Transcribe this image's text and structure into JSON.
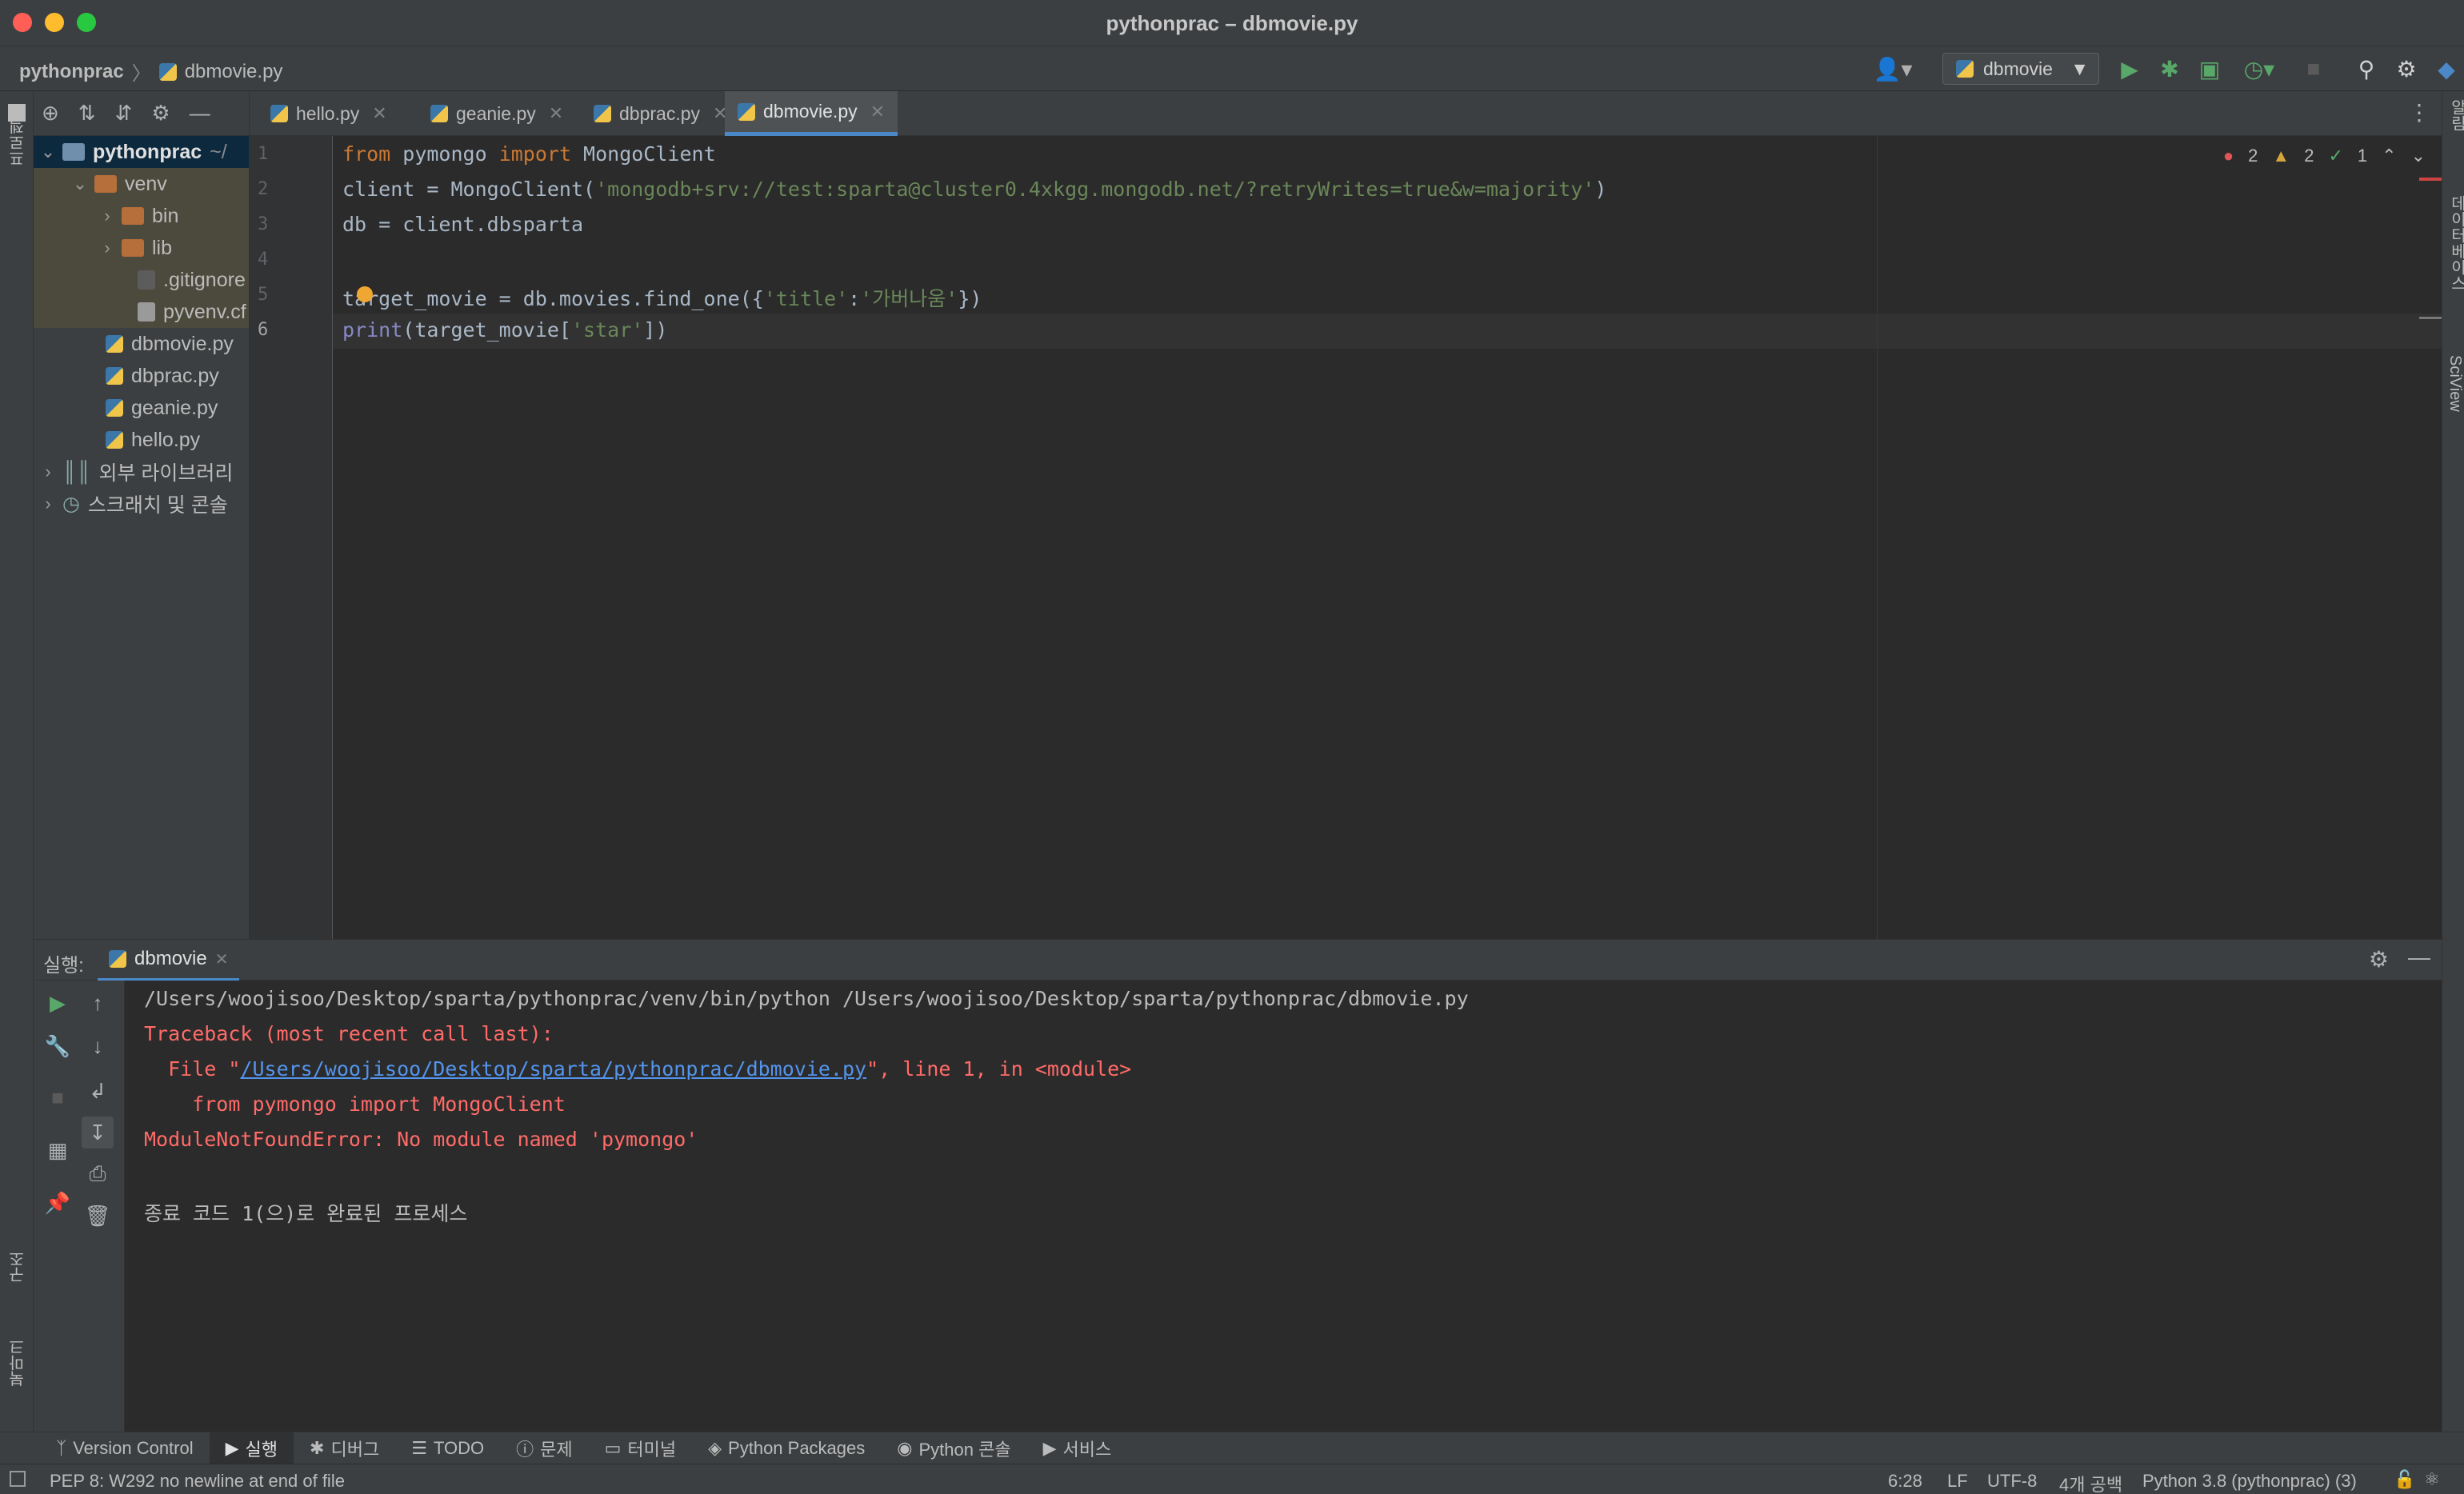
{
  "window": {
    "title": "pythonprac – dbmovie.py"
  },
  "breadcrumb": {
    "project": "pythonprac",
    "file": "dbmovie.py"
  },
  "run_config": {
    "name": "dbmovie"
  },
  "left_stripe": {
    "project_label": "프로젝트",
    "structure_label": "구조",
    "bookmarks_label": "북마크"
  },
  "right_stripe": {
    "notifications_label": "알림",
    "database_label": "데이터베이스",
    "sciview_label": "SciView"
  },
  "project_tree": [
    {
      "label": "pythonprac",
      "suffix": "~/",
      "type": "root",
      "expanded": true
    },
    {
      "label": "venv",
      "type": "folder",
      "expanded": true
    },
    {
      "label": "bin",
      "type": "folder"
    },
    {
      "label": "lib",
      "type": "folder"
    },
    {
      "label": ".gitignore",
      "type": "file"
    },
    {
      "label": "pyvenv.cf",
      "type": "file"
    },
    {
      "label": "dbmovie.py",
      "type": "py"
    },
    {
      "label": "dbprac.py",
      "type": "py"
    },
    {
      "label": "geanie.py",
      "type": "py"
    },
    {
      "label": "hello.py",
      "type": "py"
    },
    {
      "label": "외부 라이브러리",
      "type": "lib"
    },
    {
      "label": "스크래치 및 콘솔",
      "type": "scratch"
    }
  ],
  "tabs": [
    {
      "label": "hello.py"
    },
    {
      "label": "geanie.py"
    },
    {
      "label": "dbprac.py"
    },
    {
      "label": "dbmovie.py",
      "active": true
    }
  ],
  "inspections": {
    "errors": "2",
    "warnings": "2",
    "weak": "1"
  },
  "code": {
    "line_numbers": [
      "1",
      "2",
      "3",
      "4",
      "5",
      "6"
    ],
    "l1": {
      "kw1": "from",
      "mod": " pymongo ",
      "kw2": "import",
      "name": " MongoClient"
    },
    "l2": {
      "pre": "client = MongoClient(",
      "str": "'mongodb+srv://test:sparta@cluster0.4xkgg.mongodb.net/?retryWrites=true&w=majority'",
      "post": ")"
    },
    "l3": {
      "text": "db = client.dbsparta"
    },
    "l5": {
      "pre": "target_movie = db.movies.find_one({",
      "s1": "'title'",
      "colon": ":",
      "s2": "'가버나움'",
      "post": "})"
    },
    "l6": {
      "fn": "print",
      "pre": "(target_movie[",
      "str": "'star'",
      "post": "])"
    }
  },
  "run_panel": {
    "label": "실행:",
    "tab": "dbmovie",
    "lines": {
      "cmd": "/Users/woojisoo/Desktop/sparta/pythonprac/venv/bin/python /Users/woojisoo/Desktop/sparta/pythonprac/dbmovie.py",
      "tb": "Traceback (most recent call last):",
      "file_pre": "  File \"",
      "file_link": "/Users/woojisoo/Desktop/sparta/pythonprac/dbmovie.py",
      "file_post": "\", line 1, in <module>",
      "src": "    from pymongo import MongoClient",
      "err": "ModuleNotFoundError: No module named 'pymongo'",
      "exit": "종료 코드 1(으)로 완료된 프로세스"
    }
  },
  "tool_windows": [
    {
      "label": "Version Control",
      "icon": "branch-icon"
    },
    {
      "label": "실행",
      "icon": "run-icon",
      "active": true
    },
    {
      "label": "디버그",
      "icon": "bug-icon"
    },
    {
      "label": "TODO",
      "icon": "list-icon"
    },
    {
      "label": "문제",
      "icon": "info-icon"
    },
    {
      "label": "터미널",
      "icon": "terminal-icon"
    },
    {
      "label": "Python Packages",
      "icon": "layers-icon"
    },
    {
      "label": "Python 콘솔",
      "icon": "python-icon"
    },
    {
      "label": "서비스",
      "icon": "services-icon"
    }
  ],
  "status": {
    "message": "PEP 8: W292 no newline at end of file",
    "position": "6:28",
    "line_sep": "LF",
    "encoding": "UTF-8",
    "indent": "4개 공백",
    "interpreter": "Python 3.8 (pythonprac) (3)"
  },
  "colors": {
    "accent": "#4a88c7",
    "error": "#ff6b68",
    "link": "#5394ec",
    "string": "#6a8759",
    "keyword": "#cc7832"
  }
}
